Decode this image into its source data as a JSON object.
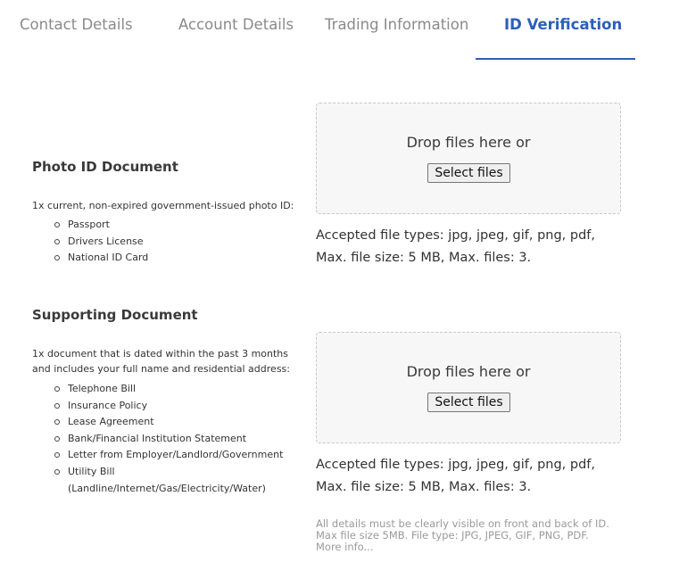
{
  "tabs": [
    {
      "label": "Contact Details",
      "active": false
    },
    {
      "label": "Account Details",
      "active": false
    },
    {
      "label": "Trading Information",
      "active": false
    },
    {
      "label": "ID Verification",
      "active": true
    }
  ],
  "accent_color": "#2d5fb8",
  "photo_id": {
    "title": "Photo ID Document",
    "description": "1x current, non-expired government-issued photo ID:",
    "items": [
      "Passport",
      "Drivers License",
      "National ID Card"
    ],
    "dropzone": {
      "drop_text": "Drop files here or",
      "button_label": "Select files"
    },
    "accepted_line1": "Accepted file types: jpg, jpeg, gif, png, pdf,",
    "accepted_line2": "Max. file size: 5 MB, Max. files: 3."
  },
  "supporting": {
    "title": "Supporting Document",
    "description_line1": "1x document that is dated within the past 3 months",
    "description_line2": "and includes your full name and residential address:",
    "items": [
      "Telephone Bill",
      "Insurance Policy",
      "Lease Agreement",
      "Bank/Financial Institution Statement",
      "Letter from Employer/Landlord/Government",
      "Utility Bill",
      "(Landline/Internet/Gas/Electricity/Water)"
    ],
    "dropzone": {
      "drop_text": "Drop files here or",
      "button_label": "Select files"
    },
    "accepted_line1": "Accepted file types: jpg, jpeg, gif, png, pdf,",
    "accepted_line2": "Max. file size: 5 MB, Max. files: 3."
  },
  "footnote": {
    "line1": "All details must be clearly visible on front and back of ID.",
    "line2": "Max file size 5MB. File type: JPG, JPEG, GIF, PNG, PDF.",
    "more_info": "More info..."
  }
}
